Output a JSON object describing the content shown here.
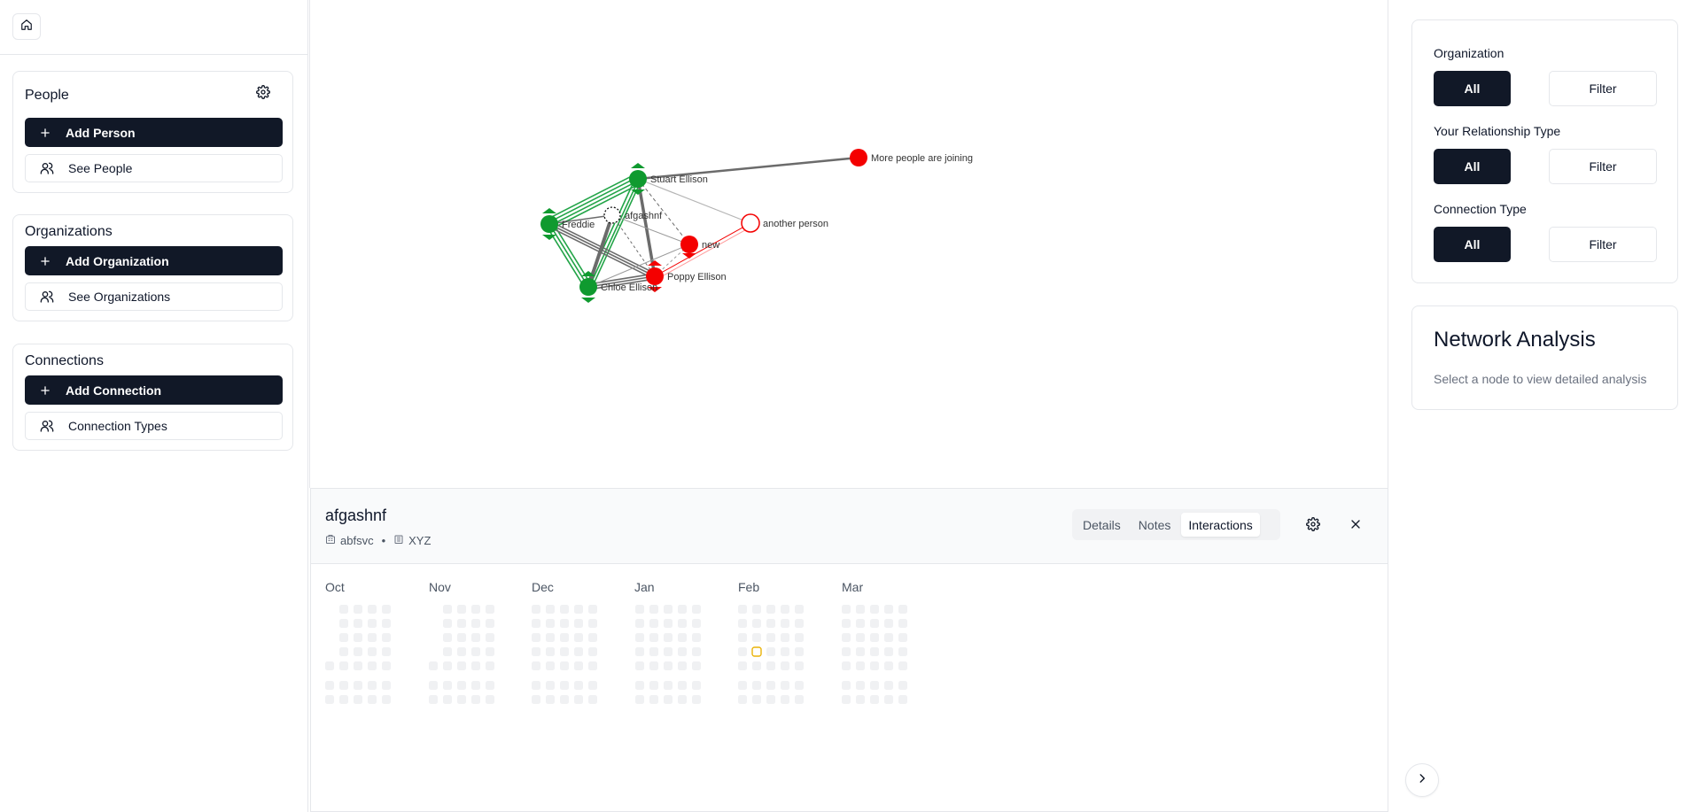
{
  "sidebar": {
    "people": {
      "title": "People",
      "add_label": "Add Person",
      "see_label": "See People"
    },
    "organizations": {
      "title": "Organizations",
      "add_label": "Add Organization",
      "see_label": "See Organizations"
    },
    "connections": {
      "title": "Connections",
      "add_label": "Add Connection",
      "see_label": "Connection Types"
    }
  },
  "graph": {
    "nodes": [
      {
        "label": "More people are joining",
        "style": "red"
      },
      {
        "label": "Stuart Ellison",
        "style": "green"
      },
      {
        "label": "afgashnf",
        "style": "selected"
      },
      {
        "label": "Freddie",
        "style": "green"
      },
      {
        "label": "another person",
        "style": "red-outline"
      },
      {
        "label": "new",
        "style": "red"
      },
      {
        "label": "Poppy Ellison",
        "style": "red"
      },
      {
        "label": "Chloe Ellison",
        "style": "green"
      }
    ],
    "colors": {
      "green": "#0f9a2f",
      "red": "#f40000",
      "edge_gray": "#6b6b6b",
      "edge_green": "#22a447"
    }
  },
  "detail_panel": {
    "name": "afgashnf",
    "organization": "abfsvc",
    "separator": "•",
    "location": "XYZ",
    "tabs": [
      "Details",
      "Notes",
      "Interactions"
    ],
    "active_tab": "Interactions",
    "months": [
      "Oct",
      "Nov",
      "Dec",
      "Jan",
      "Feb",
      "Mar"
    ],
    "highlight_color": "#eab308"
  },
  "filters": {
    "groups": [
      {
        "label": "Organization",
        "all_label": "All",
        "filter_label": "Filter"
      },
      {
        "label": "Your Relationship Type",
        "all_label": "All",
        "filter_label": "Filter"
      },
      {
        "label": "Connection Type",
        "all_label": "All",
        "filter_label": "Filter"
      }
    ]
  },
  "analysis": {
    "title": "Network Analysis",
    "subtitle": "Select a node to view detailed analysis"
  }
}
